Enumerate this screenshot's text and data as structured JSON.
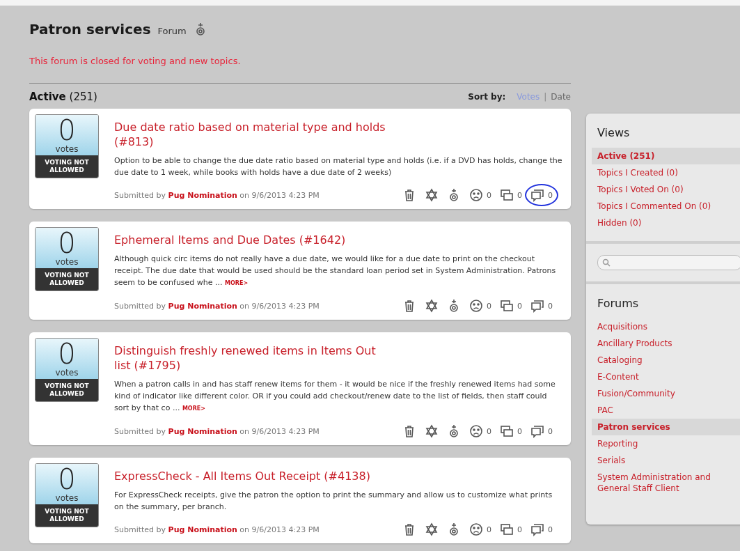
{
  "header": {
    "title": "Patron services",
    "subtitle": "Forum",
    "notice": "This forum is closed for voting and new topics."
  },
  "list_header": {
    "title": "Active",
    "count": "(251)",
    "sort_label": "Sort by:",
    "separator": "|",
    "sort_options": [
      {
        "label": "Votes",
        "selected": true
      },
      {
        "label": "Date",
        "selected": false
      }
    ]
  },
  "topics": [
    {
      "votes": "0",
      "votes_label": "votes",
      "status": "VOTING NOT ALLOWED",
      "title": "Due date ratio based on material type and holds",
      "number": "(#813)",
      "description": "Option to be able to change the due date ratio based on material type and holds (i.e. if a DVD has holds, change the due date to 1 week, while books with holds have a due date of 2 weeks)",
      "submitted_prefix": "Submitted by",
      "author": "Pug Nomination",
      "submitted_suffix": "on 9/6/2013 4:23 PM",
      "actions": [
        {
          "kind": "trash",
          "circled": false
        },
        {
          "kind": "star",
          "circled": false
        },
        {
          "kind": "medal",
          "circled": false
        },
        {
          "kind": "sad",
          "count": "0",
          "circled": false
        },
        {
          "kind": "boxes",
          "count": "0",
          "circled": false
        },
        {
          "kind": "comment",
          "count": "0",
          "circled": true
        }
      ]
    },
    {
      "votes": "0",
      "votes_label": "votes",
      "status": "VOTING NOT ALLOWED",
      "title": "Ephemeral Items and Due Dates",
      "number": "(#1642)",
      "description": "Although quick circ items do not really have a due date, we would like for a due date to print on the checkout receipt. The due date that would be used should be the standard loan period set in System Administration. Patrons seem to be confused whe ...",
      "more": "MORE>",
      "submitted_prefix": "Submitted by",
      "author": "Pug Nomination",
      "submitted_suffix": "on 9/6/2013 4:23 PM",
      "actions": [
        {
          "kind": "trash",
          "circled": false
        },
        {
          "kind": "star",
          "circled": false
        },
        {
          "kind": "medal",
          "circled": false
        },
        {
          "kind": "sad",
          "count": "0",
          "circled": false
        },
        {
          "kind": "boxes",
          "count": "0",
          "circled": false
        },
        {
          "kind": "comment",
          "count": "0",
          "circled": false
        }
      ]
    },
    {
      "votes": "0",
      "votes_label": "votes",
      "status": "VOTING NOT ALLOWED",
      "title": "Distinguish freshly renewed items in Items Out list",
      "number": "(#1795)",
      "description": "When a patron calls in and has staff renew items for them - it would be nice if the freshly renewed items had some kind of indicator like different color. OR if you could add checkout/renew date to the list of fields, then staff could sort by that co ...",
      "more": "MORE>",
      "submitted_prefix": "Submitted by",
      "author": "Pug Nomination",
      "submitted_suffix": "on 9/6/2013 4:23 PM",
      "actions": [
        {
          "kind": "trash",
          "circled": false
        },
        {
          "kind": "star",
          "circled": false
        },
        {
          "kind": "medal",
          "circled": false
        },
        {
          "kind": "sad",
          "count": "0",
          "circled": false
        },
        {
          "kind": "boxes",
          "count": "0",
          "circled": false
        },
        {
          "kind": "comment",
          "count": "0",
          "circled": false
        }
      ]
    },
    {
      "votes": "0",
      "votes_label": "votes",
      "status": "VOTING NOT ALLOWED",
      "title": "ExpressCheck - All Items Out Receipt",
      "number": "(#4138)",
      "description": "For ExpressCheck receipts, give the patron the option to print the summary and allow us to customize what prints on the summary, per branch.",
      "submitted_prefix": "Submitted by",
      "author": "Pug Nomination",
      "submitted_suffix": "on 9/6/2013 4:23 PM",
      "actions": [
        {
          "kind": "trash",
          "circled": false
        },
        {
          "kind": "star",
          "circled": false
        },
        {
          "kind": "medal",
          "circled": false
        },
        {
          "kind": "sad",
          "count": "0",
          "circled": false
        },
        {
          "kind": "boxes",
          "count": "0",
          "circled": false
        },
        {
          "kind": "comment",
          "count": "0",
          "circled": false
        }
      ]
    }
  ],
  "sidebar": {
    "views_title": "Views",
    "views": [
      {
        "label": "Active (251)",
        "selected": true
      },
      {
        "label": "Topics I Created (0)",
        "selected": false
      },
      {
        "label": "Topics I Voted On (0)",
        "selected": false
      },
      {
        "label": "Topics I Commented On (0)",
        "selected": false
      },
      {
        "label": "Hidden (0)",
        "selected": false
      }
    ],
    "forums_title": "Forums",
    "forums": [
      {
        "label": "Acquisitions",
        "selected": false
      },
      {
        "label": "Ancillary Products",
        "selected": false
      },
      {
        "label": "Cataloging",
        "selected": false
      },
      {
        "label": "E-Content",
        "selected": false
      },
      {
        "label": "Fusion/Community",
        "selected": false
      },
      {
        "label": "PAC",
        "selected": false
      },
      {
        "label": "Patron services",
        "selected": true
      },
      {
        "label": "Reporting",
        "selected": false
      },
      {
        "label": "Serials",
        "selected": false
      },
      {
        "label": "System Administration and General Staff Client",
        "selected": false
      }
    ]
  }
}
